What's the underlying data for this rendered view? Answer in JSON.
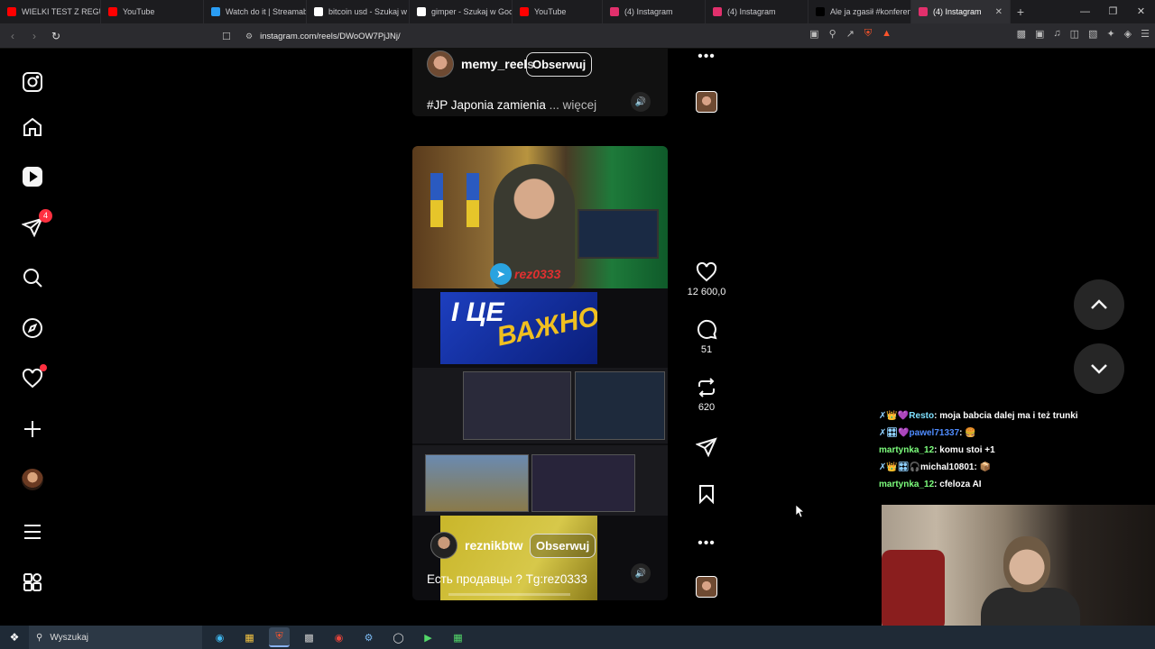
{
  "browser": {
    "tabs": [
      {
        "title": "WIELKI TEST Z REGUŁĄ...",
        "color": "#ff0000"
      },
      {
        "title": "YouTube",
        "color": "#ff0000"
      },
      {
        "title": "Watch do it | Streamab...",
        "color": "#2a9df4"
      },
      {
        "title": "bitcoin usd - Szukaj w ...",
        "color": "#ffffff"
      },
      {
        "title": "gimper - Szukaj w Goo...",
        "color": "#ffffff"
      },
      {
        "title": "YouTube",
        "color": "#ff0000"
      },
      {
        "title": "(4) Instagram",
        "color": "#e1306c"
      },
      {
        "title": "(4) Instagram",
        "color": "#e1306c"
      },
      {
        "title": "Ale ja zgasił #konferen...",
        "color": "#000000"
      },
      {
        "title": "(4) Instagram",
        "color": "#e1306c",
        "active": true
      }
    ],
    "url": "instagram.com/reels/DWoOW7PjJNj/"
  },
  "sidebar": {
    "messages_badge": "4"
  },
  "reel_top": {
    "username": "memy_reels",
    "follow_label": "Obserwuj",
    "caption": "#JP Japonia zamienia",
    "more_label": "... więcej"
  },
  "reel_main": {
    "telegram_tag": "rez0333",
    "frame_text_white": "І ЦЕ",
    "frame_text_yellow": "ВАЖНО",
    "username": "reznikbtw",
    "follow_label": "Obserwuj",
    "caption": "Есть продавцы ? Tg:rez0333"
  },
  "actions": {
    "likes": "12 600,0",
    "comments": "51",
    "reposts": "620"
  },
  "chat": [
    {
      "user": "Resto",
      "text": "moja babcia dalej ma i też trunki",
      "color": "#7ee0ff",
      "badges": "✗👑💜"
    },
    {
      "user": "pawel71337",
      "text": "🍔",
      "color": "#4f8cff",
      "badges": "✗🎛💜"
    },
    {
      "user": "martynka_12",
      "text": "komu stoi +1",
      "color": "#7dff7d",
      "badges": ""
    },
    {
      "user": "michal10801",
      "text": "📦",
      "color": "#ffffff",
      "badges": "✗👑🎛🎧"
    },
    {
      "user": "martynka_12",
      "text": "cfeloza AI",
      "color": "#7dff7d",
      "badges": ""
    }
  ],
  "taskbar": {
    "search_placeholder": "Wyszukaj"
  }
}
